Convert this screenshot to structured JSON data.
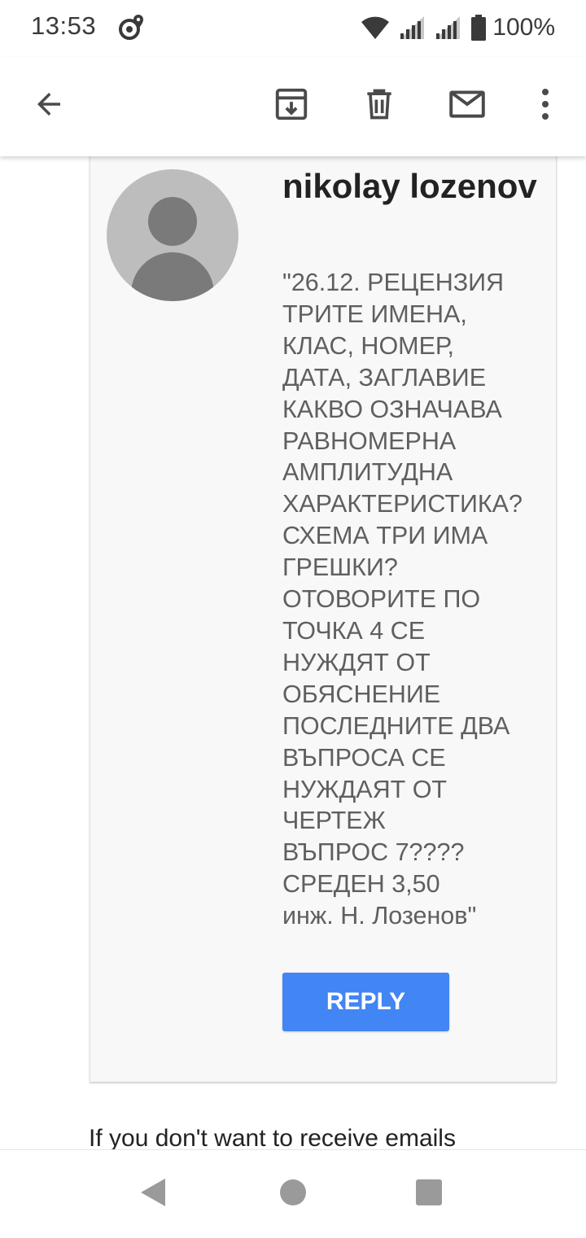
{
  "status_bar": {
    "time": "13:53",
    "battery": "100%",
    "icons": [
      "location-icon",
      "wifi-icon",
      "signal-icon",
      "signal-icon",
      "battery-icon"
    ]
  },
  "toolbar": {
    "icons": [
      "back-arrow-icon",
      "archive-icon",
      "delete-icon",
      "mail-icon",
      "more-vert-icon"
    ]
  },
  "email": {
    "sender": "nikolay lozenov",
    "message": "\"26.12. РЕЦЕНЗИЯ\nТРИТЕ ИМЕНА,\nКЛАС, НОМЕР,\nДАТА, ЗАГЛАВИЕ\nКАКВО ОЗНАЧАВА\nРАВНОМЕРНА\nАМПЛИТУДНА\nХАРАКТЕРИСТИКА?\nСХЕМА ТРИ ИМА\nГРЕШКИ?\nОТОВОРИТЕ ПО\nТОЧКА 4 СЕ\nНУЖДЯТ ОТ\nОБЯСНЕНИЕ\nПОСЛЕДНИТЕ ДВА\nВЪПРОСА СЕ\nНУЖДАЯТ ОТ\nЧЕРТЕЖ\nВЪПРОС 7????\nСРЕДЕН 3,50\nинж. Н. Лозенов\"",
    "reply_label": "REPLY",
    "footer_text": "If you don't want to receive emails"
  },
  "nav_bar": {
    "icons": [
      "back-triangle-icon",
      "home-circle-icon",
      "recents-square-icon"
    ]
  },
  "colors": {
    "accent": "#4285f4",
    "card_bg": "#f8f8f8",
    "avatar_bg": "#bdbdbd"
  }
}
